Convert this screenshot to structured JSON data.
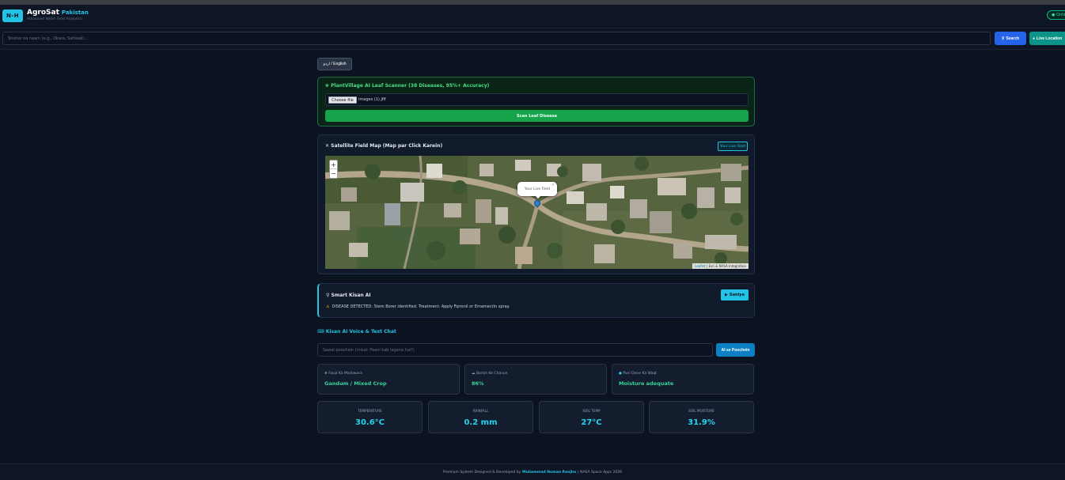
{
  "header": {
    "logo_text": "N-H",
    "brand_name": "AgroSat",
    "brand_region": "Pakistan",
    "brand_tagline": "Advanced NASA Field Analytics",
    "status": "● Online"
  },
  "search": {
    "placeholder": "Shehar ka naam (e.g., Okara, Sahiwal)...",
    "search_icon": "search-icon",
    "search_label": "Search",
    "location_icon": "location-pin-icon",
    "live_location_label": "Live Location"
  },
  "language_toggle": "اردو / English",
  "scanner": {
    "icon": "seedling-icon",
    "title": "PlantVillage AI Leaf Scanner (38 Diseases, 95%+ Accuracy)",
    "choose_file_label": "Choose file",
    "file_name": "images (1).jfif",
    "scan_button": "Scan Leaf Disease"
  },
  "map": {
    "icon": "satellite-icon",
    "title": "Satellite Field Map (Map par Click Karein)",
    "live_tag": "Your Live Field",
    "zoom_in": "+",
    "zoom_out": "−",
    "popup_text": "Your Live Field",
    "popup_close": "×",
    "attribution_link": "Leaflet",
    "attribution_rest": " | Esri & NASA Integration"
  },
  "smart_ai": {
    "icon": "microphone-icon",
    "title": "Smart Kisan AI",
    "listen_icon": "play-icon",
    "listen_label": "Suniye",
    "warning_icon": "warning-icon",
    "message": "DISEASE DETECTED: Stem Borer identified. Treatment: Apply Fipronil or Emamectin spray."
  },
  "chat": {
    "icon": "keyboard-icon",
    "title": "Kisan AI Voice & Text Chat",
    "placeholder": "Sawal poochein (misal: Paani kab lagana hai?)",
    "ask_button": "AI se Poochein"
  },
  "info_cards": [
    {
      "icon": "seedling-icon",
      "label": "Fasal Ka Mashwara",
      "value": "Gandum / Mixed Crop"
    },
    {
      "icon": "cloud-icon",
      "label": "Barish Ke Chance",
      "value": "86%"
    },
    {
      "icon": "water-drop-icon",
      "label": "Pani Dene Ka Waqt",
      "value": "Moisture adequate"
    }
  ],
  "metrics": [
    {
      "label": "TEMPERATURE",
      "value": "30.6°C"
    },
    {
      "label": "RAINFALL",
      "value": "0.2 mm"
    },
    {
      "label": "SOIL TEMP",
      "value": "27°C"
    },
    {
      "label": "SOIL MOISTURE",
      "value": "31.9%"
    }
  ],
  "footer": {
    "prefix": "Premium System Designed & Developed by",
    "author": "Muhammad Noman Ranjha",
    "suffix": "| NASA Space Apps 2026"
  },
  "colors": {
    "background": "#0b1220",
    "accent": "#22c3e6",
    "success": "#16a34a",
    "primary": "#2563eb"
  }
}
